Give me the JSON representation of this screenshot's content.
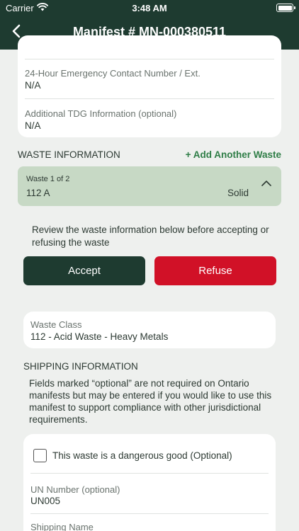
{
  "status_bar": {
    "carrier": "Carrier",
    "time": "3:48 AM"
  },
  "header": {
    "title": "Manifest # MN-000380511"
  },
  "contact_card": {
    "emergency_label": "24-Hour Emergency Contact Number / Ext.",
    "emergency_value": "N/A",
    "tdg_label": "Additional TDG Information (optional)",
    "tdg_value": "N/A"
  },
  "waste_section": {
    "title": "WASTE INFORMATION",
    "add_label": "+ Add Another Waste"
  },
  "waste_item": {
    "count": "Waste 1 of 2",
    "code": "112 A",
    "type": "Solid"
  },
  "review": {
    "message": "Review the waste information below before accepting or refusing the waste",
    "accept_label": "Accept",
    "refuse_label": "Refuse"
  },
  "waste_class": {
    "label": "Waste Class",
    "value": "112 - Acid Waste - Heavy Metals"
  },
  "shipping": {
    "title": "SHIPPING INFORMATION",
    "note": "Fields marked “optional” are not required on Ontario manifests but may be entered if you would like to use this manifest to support compliance with other jurisdictional requirements.",
    "dangerous_good_label": "This waste is a dangerous good (Optional)",
    "dangerous_good_checked": false,
    "un_label": "UN Number (optional)",
    "un_value": "UN005",
    "shipping_name_label": "Shipping Name"
  },
  "colors": {
    "header_bg": "#1e3b30",
    "accent_green": "#2e7d46",
    "waste_box_bg": "#c7d9c5",
    "accept_bg": "#1e3b30",
    "refuse_bg": "#d11127",
    "page_bg": "#eef0ee"
  },
  "icons": [
    "wifi-icon",
    "battery-icon",
    "back-chevron-icon",
    "chevron-up-icon"
  ]
}
